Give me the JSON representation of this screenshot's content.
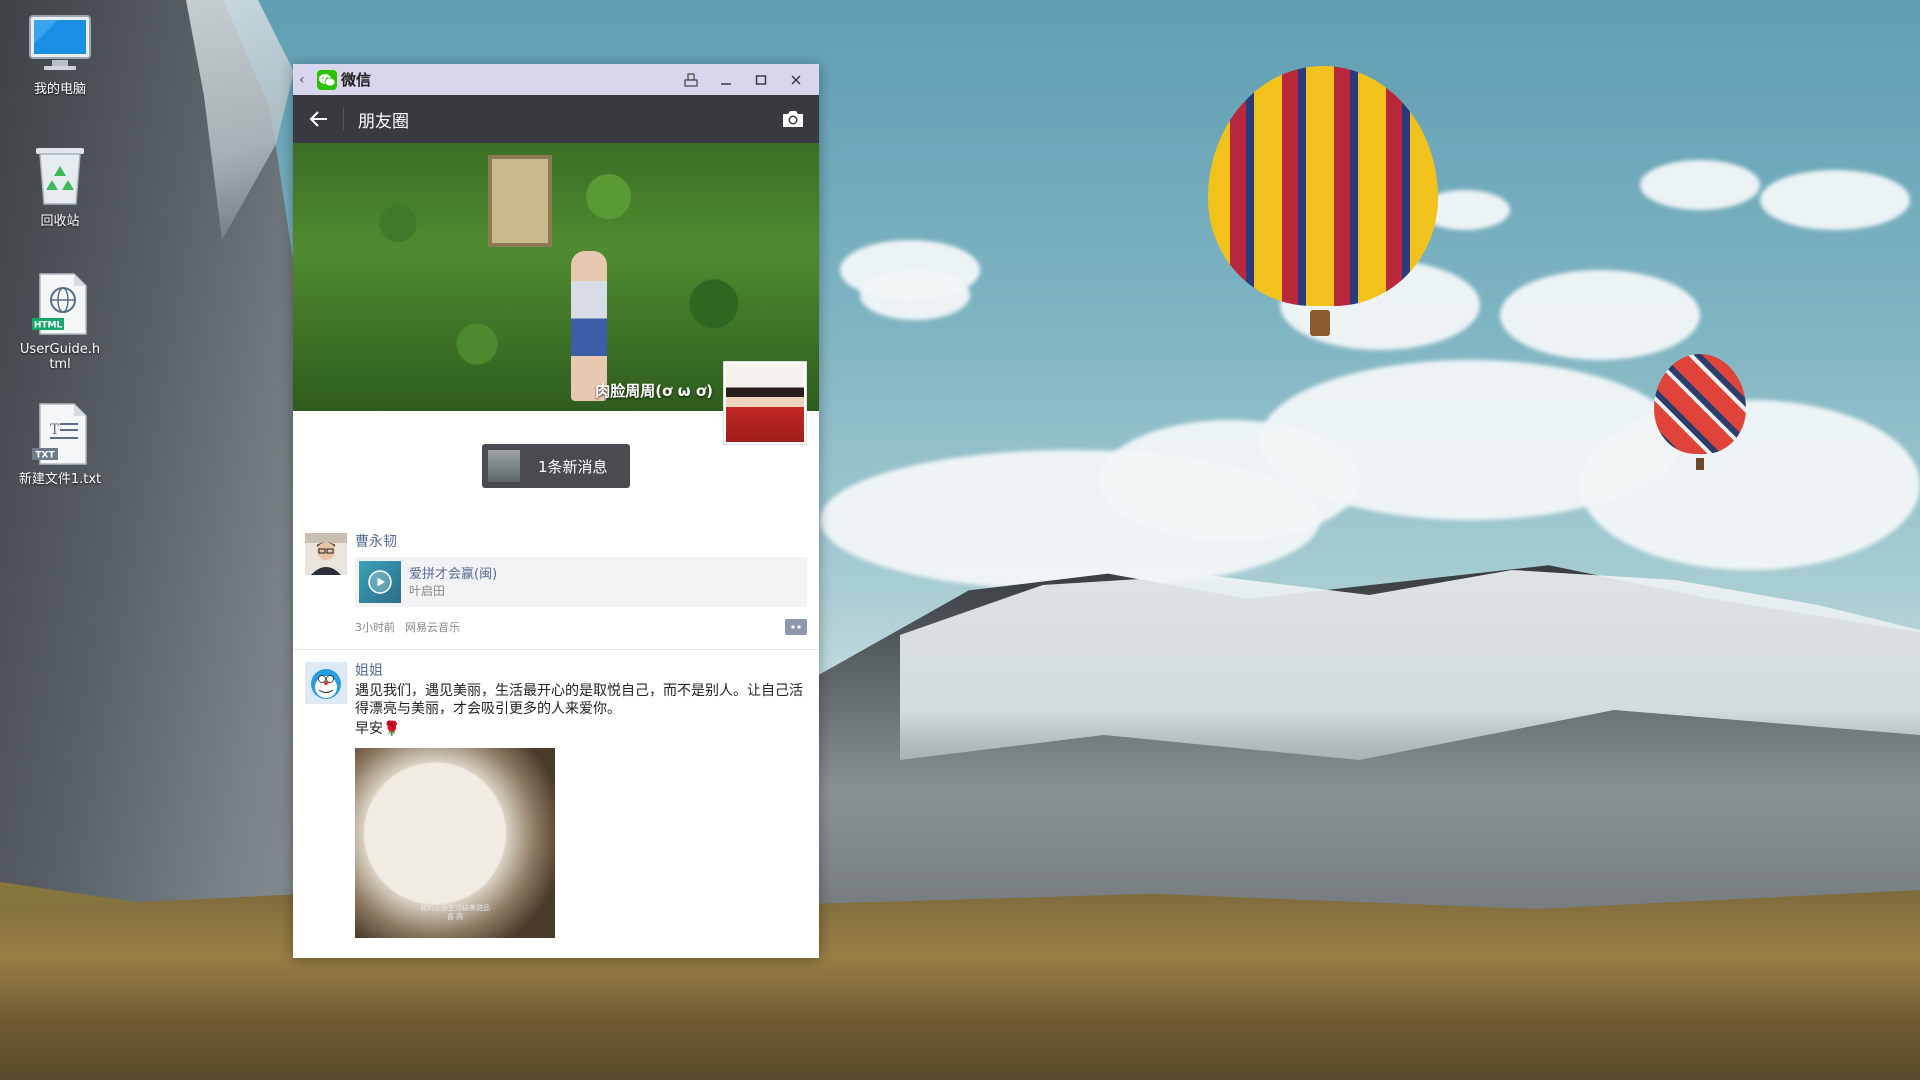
{
  "desktop": {
    "icons": [
      {
        "label": "我的电脑",
        "icon": "computer-icon"
      },
      {
        "label": "回收站",
        "icon": "recycle-bin-icon"
      },
      {
        "label": "UserGuide.html",
        "icon": "html-file-icon",
        "badge": "HTML"
      },
      {
        "label": "新建文件1.txt",
        "icon": "txt-file-icon",
        "badge": "TXT"
      }
    ]
  },
  "window": {
    "app_name": "微信",
    "buttons": [
      "back-chevron",
      "pin",
      "minimize",
      "maximize",
      "close"
    ]
  },
  "header": {
    "title": "朋友圈"
  },
  "cover": {
    "nickname": "肉脸周周(ơ ω ơ)"
  },
  "new_messages": {
    "label": "1条新消息"
  },
  "posts": [
    {
      "name": "曹永韧",
      "music": {
        "song": "爱拼才会赢(闽)",
        "artist": "叶启田"
      },
      "time": "3小时前",
      "source": "网易云音乐"
    },
    {
      "name": "姐姐",
      "text": "遇见我们，遇见美丽，生活最开心的是取悦自己，而不是别人。让自己活得漂亮与美丽，才会吸引更多的人来爱你。",
      "text2": "早安🌹",
      "photo_caption": "我的正面生活缺美甜品",
      "photo_caption2": "喜 燕"
    }
  ],
  "colors": {
    "titlebar": "#d9d5ed",
    "header": "#393a3f",
    "link_blue": "#576b95",
    "wechat_green": "#2dc100"
  }
}
